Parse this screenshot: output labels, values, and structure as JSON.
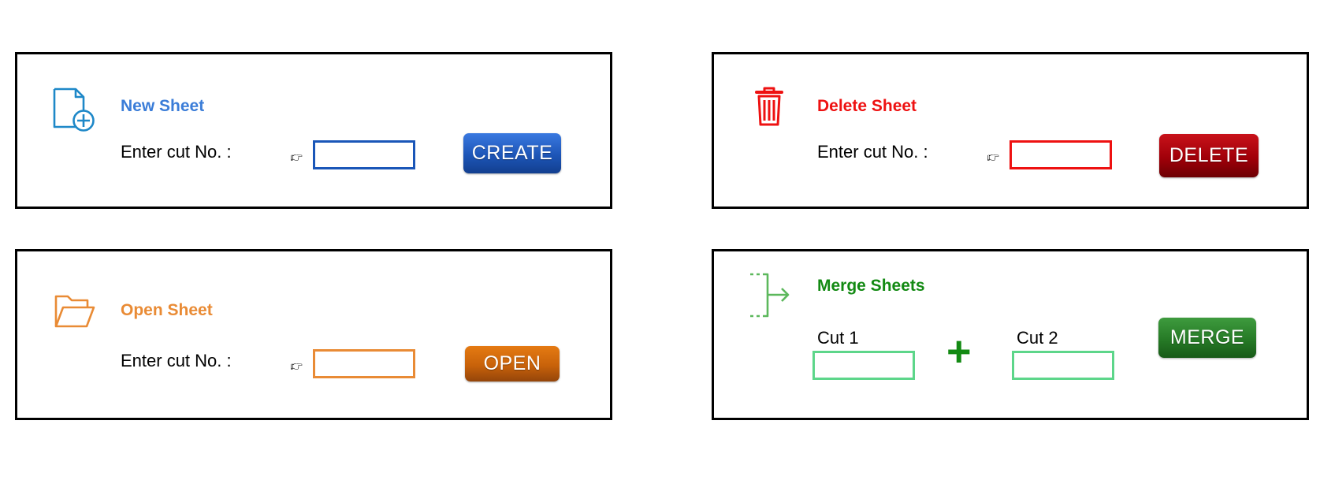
{
  "colors": {
    "new": "#3b7dd8",
    "new_field_border": "#1a56b8",
    "delete": "#ee1111",
    "open": "#e98b35",
    "merge": "#138a13",
    "merge_field_border": "#5dd68a"
  },
  "new_sheet": {
    "icon": "new-file-icon",
    "title": "New Sheet",
    "label": "Enter cut No. :",
    "pointer_icon": "pointing-hand-icon",
    "input_value": "",
    "button_label": "CREATE"
  },
  "delete_sheet": {
    "icon": "trash-icon",
    "title": "Delete Sheet",
    "label": "Enter cut No. :",
    "pointer_icon": "pointing-hand-icon",
    "input_value": "",
    "button_label": "DELETE"
  },
  "open_sheet": {
    "icon": "open-folder-icon",
    "title": "Open Sheet",
    "label": "Enter cut No. :",
    "pointer_icon": "pointing-hand-icon",
    "input_value": "",
    "button_label": "OPEN"
  },
  "merge_sheets": {
    "icon": "merge-icon",
    "title": "Merge Sheets",
    "cut1_label": "Cut 1",
    "cut1_value": "",
    "plus_symbol": "+",
    "cut2_label": "Cut 2",
    "cut2_value": "",
    "button_label": "MERGE"
  }
}
